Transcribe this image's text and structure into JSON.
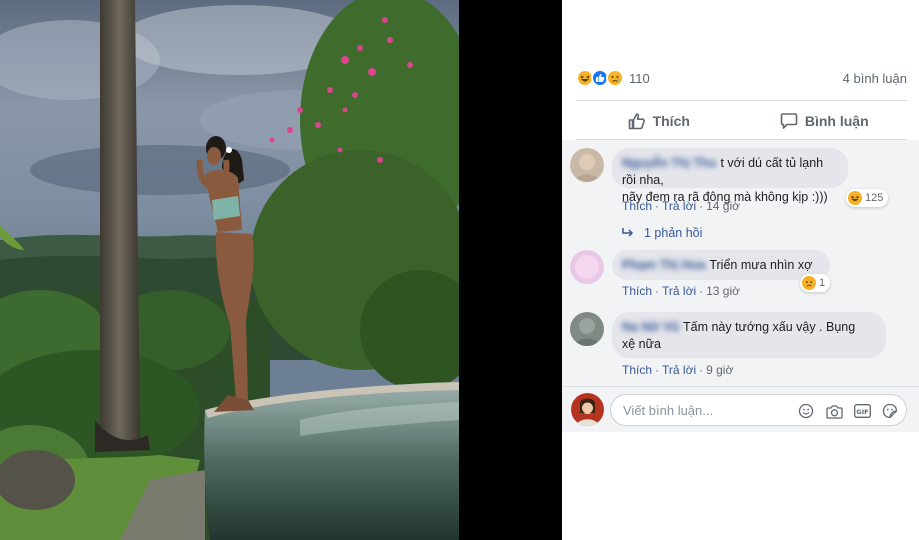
{
  "post": {
    "reaction_count": "110",
    "comment_count": "4 bình luận",
    "reaction_icons": [
      "haha-icon",
      "like-icon",
      "sad-icon"
    ]
  },
  "actions": {
    "like_label": "Thích",
    "comment_label": "Bình luận"
  },
  "comments": [
    {
      "author": "Nguyễn Thị Thu",
      "text": "t với dú cất tủ lạnh rồi nha, nãy đem ra rã đông mà không kịp :)))",
      "line1": "t với dú cất tủ lạnh rồi nha,",
      "line2": "nãy đem ra rã đông mà không kịp :)))",
      "reaction_count": "125",
      "reaction_icon": "haha-icon",
      "like": "Thích",
      "reply": "Trả lời",
      "time": "14 giờ",
      "replies_label": "1 phản hồi"
    },
    {
      "author": "Phạm Thị Hoa",
      "text": "Triển mưa nhìn xợ",
      "reaction_count": "1",
      "reaction_icon": "sad-icon",
      "like": "Thích",
      "reply": "Trả lời",
      "time": "13 giờ"
    },
    {
      "author": "Na Nữ Vũ",
      "line1": "Tấm này tướng xấu vậy . Bụng",
      "line2": "xệ nữa",
      "like": "Thích",
      "reply": "Trả lời",
      "time": "9 giờ"
    }
  ],
  "composer": {
    "placeholder": "Viết bình luận..."
  },
  "colors": {
    "link": "#385898",
    "meta": "#606770",
    "comment_bg": "#f2f3f5",
    "bubble_bg": "#e4e6eb",
    "like_blue": "#1877f2",
    "reaction_yellow": "#f7b125"
  }
}
